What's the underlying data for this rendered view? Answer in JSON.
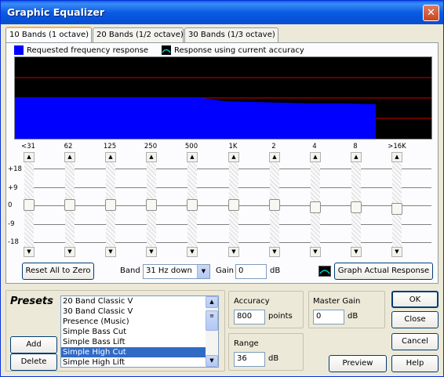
{
  "window": {
    "title": "Graphic Equalizer"
  },
  "tabs": [
    {
      "label": "10 Bands (1 octave)",
      "active": true
    },
    {
      "label": "20 Bands (1/2 octave)",
      "active": false
    },
    {
      "label": "30 Bands (1/3 octave)",
      "active": false
    }
  ],
  "legend": {
    "requested": "Requested frequency response",
    "current": "Response using current accuracy"
  },
  "colors": {
    "requested": "#0000ff",
    "current": "#00cccc",
    "graph_bg": "#000000",
    "graph_lines": "#ff0000",
    "selection": "#316ac5"
  },
  "bands": [
    {
      "label": "<31",
      "level": 0
    },
    {
      "label": "62",
      "level": 0
    },
    {
      "label": "125",
      "level": 0
    },
    {
      "label": "250",
      "level": 0
    },
    {
      "label": "500",
      "level": 0
    },
    {
      "label": "1K",
      "level": 0
    },
    {
      "label": "2",
      "level": 0
    },
    {
      "label": "4",
      "level": -1.5
    },
    {
      "label": "8",
      "level": -1.5
    },
    {
      "label": ">16K",
      "level": -2
    }
  ],
  "scale": [
    "+18",
    "+9",
    "0",
    "-9",
    "-18"
  ],
  "controls": {
    "reset": "Reset All to Zero",
    "band_label": "Band",
    "band_value": "31 Hz down",
    "gain_label": "Gain",
    "gain_value": "0",
    "gain_unit": "dB",
    "graph_actual": "Graph Actual Response"
  },
  "presets": {
    "title": "Presets",
    "add": "Add",
    "delete": "Delete",
    "items": [
      "20 Band Classic V",
      "30 Band Classic V",
      "Presence (Music)",
      "Simple Bass Cut",
      "Simple Bass Lift",
      "Simple High Cut",
      "Simple High Lift"
    ],
    "selected": "Simple High Cut"
  },
  "accuracy": {
    "label": "Accuracy",
    "value": "800",
    "unit": "points"
  },
  "range": {
    "label": "Range",
    "value": "36",
    "unit": "dB"
  },
  "master_gain": {
    "label": "Master Gain",
    "value": "0",
    "unit": "dB"
  },
  "buttons": {
    "ok": "OK",
    "close": "Close",
    "cancel": "Cancel",
    "preview": "Preview",
    "help": "Help"
  }
}
